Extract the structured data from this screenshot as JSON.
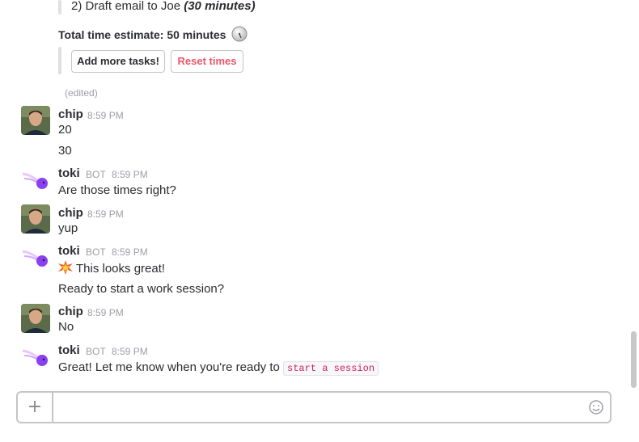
{
  "messages_top": {
    "task_line_text": "2) Draft email to Joe ",
    "task_line_time": "(30 minutes)",
    "total_estimate": "Total time estimate: 50 minutes",
    "add_tasks_button": "Add more tasks!",
    "reset_times_button": "Reset times",
    "edited_label": "(edited)"
  },
  "users": {
    "chip": "chip",
    "toki": "toki",
    "bot_badge": "BOT"
  },
  "timestamps": {
    "t": "8:59 PM"
  },
  "chat": [
    {
      "author": "chip",
      "lines": [
        "20",
        "30"
      ]
    },
    {
      "author": "toki",
      "lines": [
        "Are those times right?"
      ]
    },
    {
      "author": "chip",
      "lines": [
        "yup"
      ]
    },
    {
      "author": "toki",
      "lines": [
        "This looks great!",
        "Ready to start a work session?"
      ]
    },
    {
      "author": "chip",
      "lines": [
        "No"
      ]
    },
    {
      "author": "toki",
      "lines": [
        "Great! Let me know when you're ready to "
      ],
      "code": "start a session"
    }
  ],
  "composer": {
    "plus_icon": "+",
    "placeholder": ""
  },
  "colors": {
    "accent_red": "#e8586a",
    "toki_purple": "#8b3ff2"
  }
}
